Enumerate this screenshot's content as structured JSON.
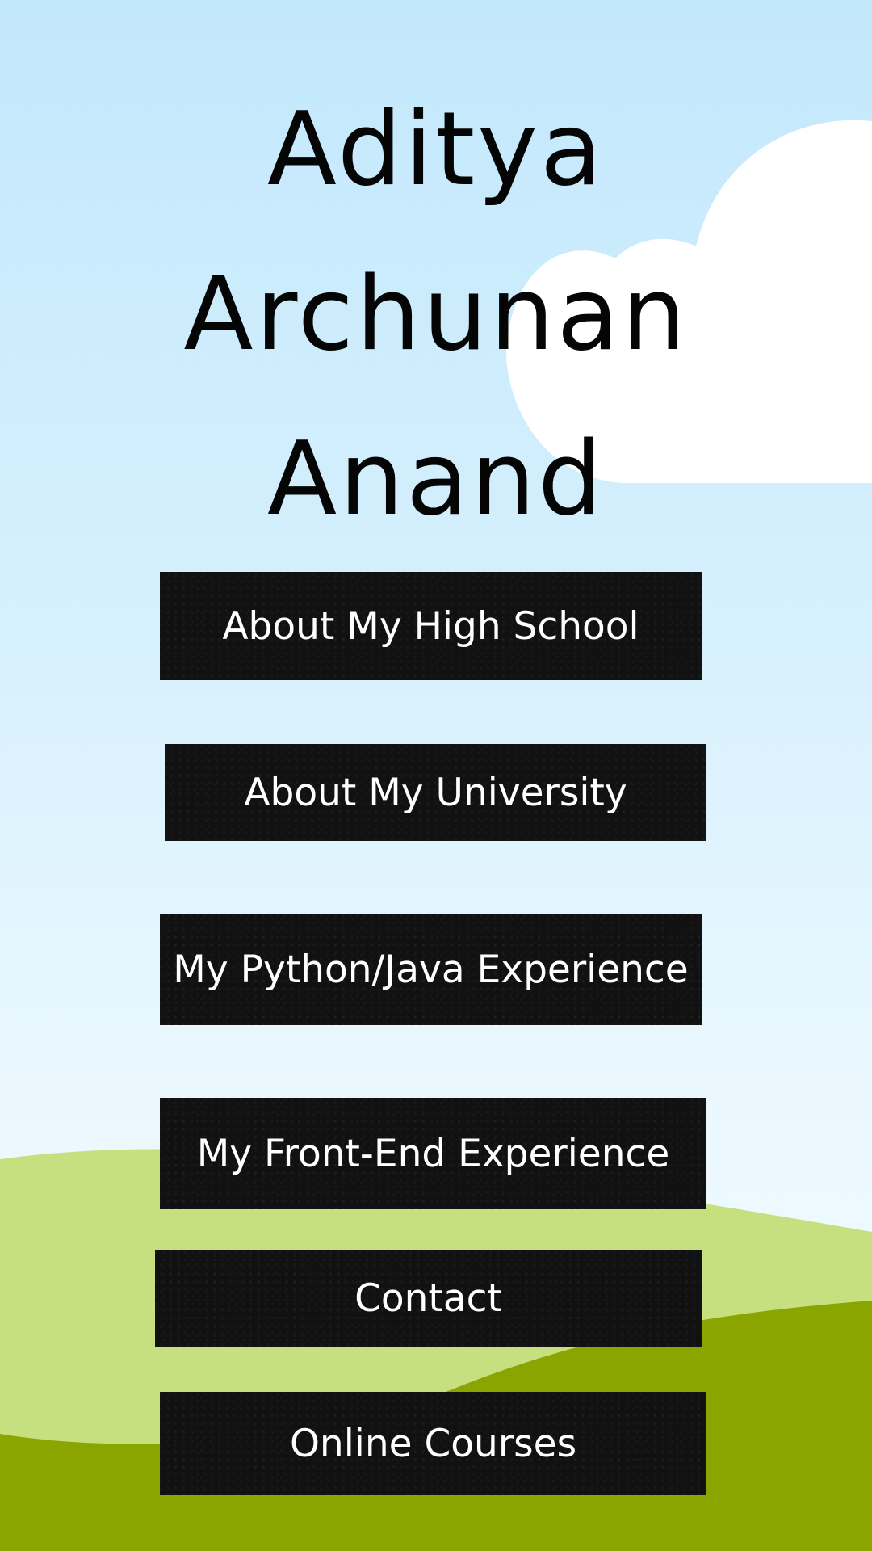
{
  "header": {
    "name_line_1": "Aditya",
    "name_line_2": "Archunan",
    "name_line_3": "Anand"
  },
  "nav": {
    "buttons": [
      {
        "label": "About My High School"
      },
      {
        "label": "About My University"
      },
      {
        "label": "My Python/Java Experience"
      },
      {
        "label": "My Front-End Experience"
      },
      {
        "label": "Contact"
      },
      {
        "label": "Online Courses"
      }
    ]
  },
  "colors": {
    "sky_top": "#c2e8fc",
    "sky_bottom": "#f2fbff",
    "light_hill": "#c6e080",
    "dark_hill": "#8aa500",
    "cloud": "#ffffff",
    "button_bg": "#111111",
    "button_text": "#ffffff",
    "name_text": "#050505"
  }
}
